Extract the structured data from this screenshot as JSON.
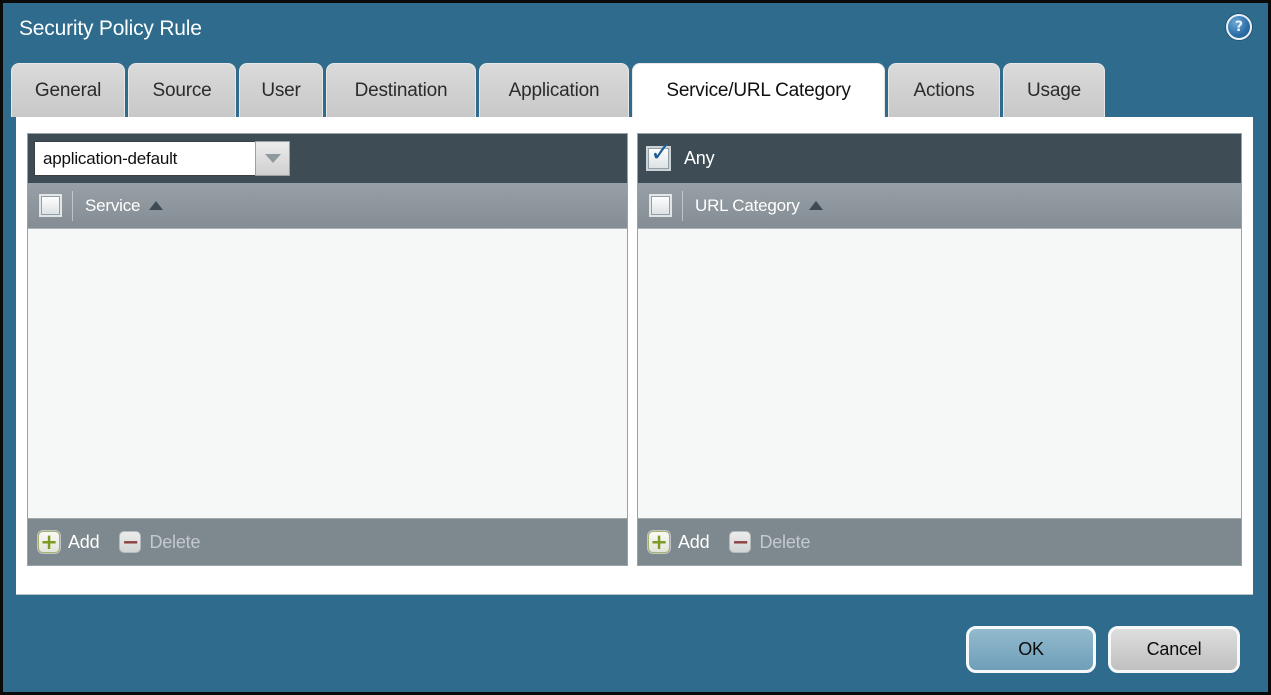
{
  "window": {
    "title": "Security Policy Rule"
  },
  "icons": {
    "help": "?",
    "add": "+",
    "delete": "−",
    "check": "✓"
  },
  "tabs": [
    {
      "label": "General",
      "active": false
    },
    {
      "label": "Source",
      "active": false
    },
    {
      "label": "User",
      "active": false
    },
    {
      "label": "Destination",
      "active": false
    },
    {
      "label": "Application",
      "active": false
    },
    {
      "label": "Service/URL Category",
      "active": true
    },
    {
      "label": "Actions",
      "active": false
    },
    {
      "label": "Usage",
      "active": false
    }
  ],
  "service_panel": {
    "dropdown_value": "application-default",
    "column_header": "Service",
    "select_all_checked": false,
    "rows": [],
    "add_label": "Add",
    "delete_label": "Delete",
    "delete_disabled": true
  },
  "url_category_panel": {
    "any_label": "Any",
    "any_checked": true,
    "column_header": "URL Category",
    "select_all_checked": false,
    "rows": [],
    "add_label": "Add",
    "delete_label": "Delete",
    "delete_disabled": true
  },
  "dialog_buttons": {
    "ok": "OK",
    "cancel": "Cancel"
  },
  "colors": {
    "titlebar_teal": "#2f6b8c",
    "panel_header_dark": "#3e4c56",
    "column_header_gray": "#8b949b",
    "footer_gray": "#7e888f",
    "inactive_tab_bg": "#cfcfcf",
    "active_tab_bg": "#ffffff",
    "ok_button_bg": "#78a7c0",
    "cancel_button_bg": "#cdcdcd",
    "add_icon_green": "#7c9a21",
    "delete_icon_red": "#8d4040",
    "checkmark_blue": "#1e5f97",
    "help_icon_blue": "#2b6da6"
  }
}
